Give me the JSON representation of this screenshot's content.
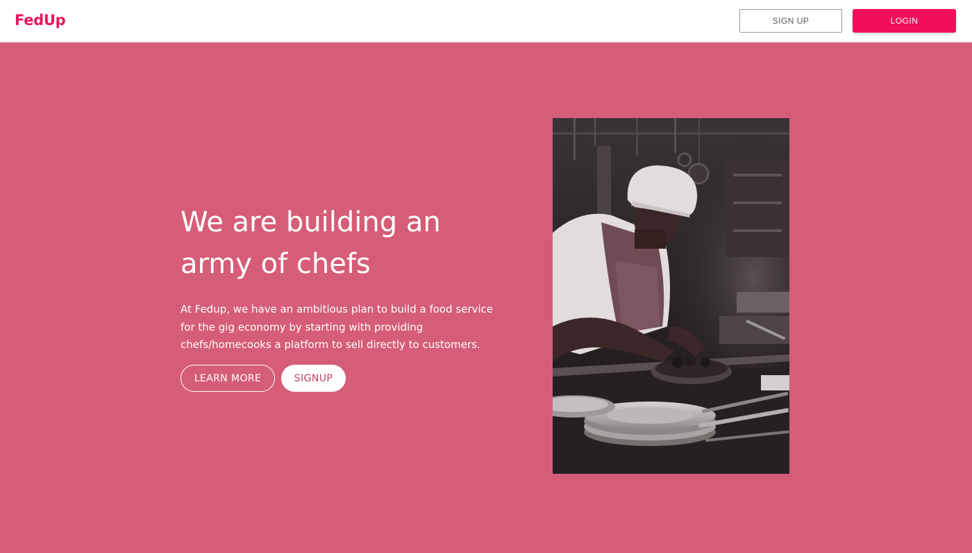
{
  "header": {
    "logo": "FedUp",
    "signup_label": "SIGN UP",
    "login_label": "LOGIN"
  },
  "hero": {
    "headline": "We are building an army of chefs",
    "description": "At Fedup, we have an ambitious plan to build a food service for the gig economy by starting with providing chefs/homecooks a platform to sell directly to customers.",
    "learn_more_label": "LEARN MORE",
    "signup_label": "SIGNUP",
    "image": "chef-photo"
  },
  "colors": {
    "brand": "#e8185a",
    "login_button": "#f20f5a",
    "hero_background": "#d65d77"
  }
}
